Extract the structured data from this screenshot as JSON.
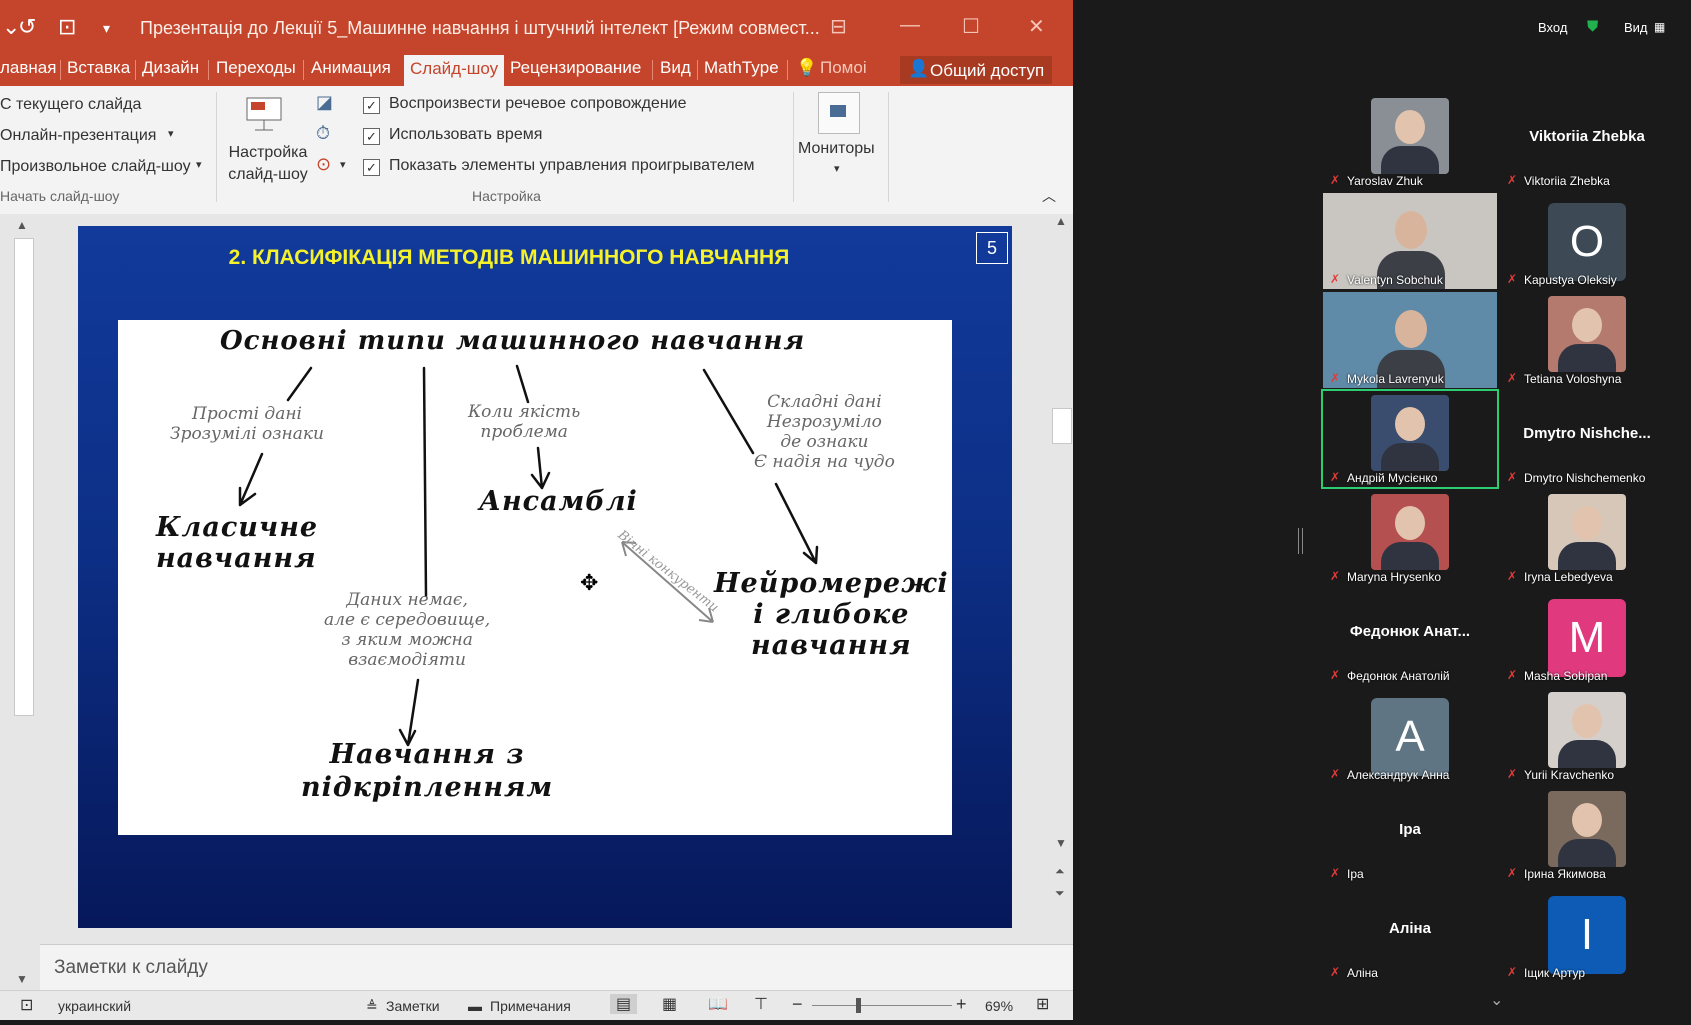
{
  "ppt": {
    "title": "Презентація до Лекції 5_Машинне навчання і штучний інтелект [Режим совмест...",
    "tabs": [
      "лавная",
      "Вставка",
      "Дизайн",
      "Переходы",
      "Анимация",
      "Слайд-шоу",
      "Рецензирование",
      "Вид",
      "MathType",
      "Помоi"
    ],
    "active_tab": "Слайд-шоу",
    "share_label": "Общий доступ",
    "ribbon": {
      "start_items": [
        "С текущего слайда",
        "Онлайн-презентация",
        "Произвольное слайд-шоу"
      ],
      "start_group": "Начать слайд-шоу",
      "setup_button": "Настройка слайд-шоу",
      "checkboxes": [
        {
          "label": "Воспроизвести речевое сопровождение",
          "checked": true
        },
        {
          "label": "Использовать время",
          "checked": true
        },
        {
          "label": "Показать элементы управления проигрывателем",
          "checked": true
        }
      ],
      "setup_group": "Настройка",
      "monitors_label": "Мониторы"
    },
    "slide": {
      "number": "5",
      "title": "2. КЛАСИФІКАЦІЯ МЕТОДІВ МАШИННОГО НАВЧАННЯ",
      "heading": "Основні типи машинного навчання",
      "note1": "Прості дані\nЗрозумілі ознаки",
      "note2": "Коли якість\nпроблема",
      "note3": "Складні дані\nНезрозуміло\nде ознаки\nЄ надія на чудо",
      "note4": "Даних немає,\nале є середовище,\nз яким можна\nвзаємодіяти",
      "note5": "Вічні конкуренти",
      "classic": "Класичне\nнавчання",
      "ensembles": "Ансамблі",
      "neural": "Нейромережі\nі глибоке\nнавчання",
      "rl": "Навчання з\nпідкріпленням"
    },
    "notes_placeholder": "Заметки к слайду",
    "status": {
      "language": "украинский",
      "notes": "Заметки",
      "comments": "Примечания",
      "zoom": "69%"
    }
  },
  "zoom": {
    "top_login": "Вход",
    "top_view": "Вид",
    "participants": [
      {
        "name": "Yaroslav Zhuk",
        "type": "photo",
        "bg": "#8a8f96"
      },
      {
        "name": "Viktoriia Zhebka",
        "type": "text",
        "display": "Viktoriia Zhebka"
      },
      {
        "name": "Valentyn Sobchuk",
        "type": "video",
        "bg": "#c9c6c2"
      },
      {
        "name": "Kapustya Oleksiy",
        "type": "avatar",
        "letter": "O",
        "color": "#3d4a55"
      },
      {
        "name": "Mykola Lavrenyuk",
        "type": "video",
        "bg": "#5f8aa8"
      },
      {
        "name": "Tetiana Voloshyna",
        "type": "photo",
        "bg": "#b47a6e"
      },
      {
        "name": "Андрій Мусієнко",
        "type": "photo",
        "bg": "#3b4d6e",
        "active": true
      },
      {
        "name": "Dmytro Nishchemenko",
        "type": "text",
        "display": "Dmytro  Nishche..."
      },
      {
        "name": "Maryna Hrysenko",
        "type": "photo",
        "bg": "#b55050"
      },
      {
        "name": "Iryna Lebedyeva",
        "type": "photo",
        "bg": "#d7c7b8"
      },
      {
        "name": "Федонюк Анатолій",
        "type": "text",
        "display": "Федонюк  Анат..."
      },
      {
        "name": "Masha Sobipan",
        "type": "avatar",
        "letter": "M",
        "color": "#e0397e"
      },
      {
        "name": "Александрук Анна",
        "type": "avatar",
        "letter": "A",
        "color": "#5f7584"
      },
      {
        "name": "Yurii Kravchenko",
        "type": "photo",
        "bg": "#d4cfcb"
      },
      {
        "name": "Іра",
        "type": "text",
        "display": "Іра"
      },
      {
        "name": "Ірина Якимова",
        "type": "photo",
        "bg": "#7a6a5e"
      },
      {
        "name": "Аліна",
        "type": "text",
        "display": "Аліна"
      },
      {
        "name": "Іщик Артур",
        "type": "avatar",
        "letter": "I",
        "color": "#0e5bb5"
      }
    ]
  }
}
